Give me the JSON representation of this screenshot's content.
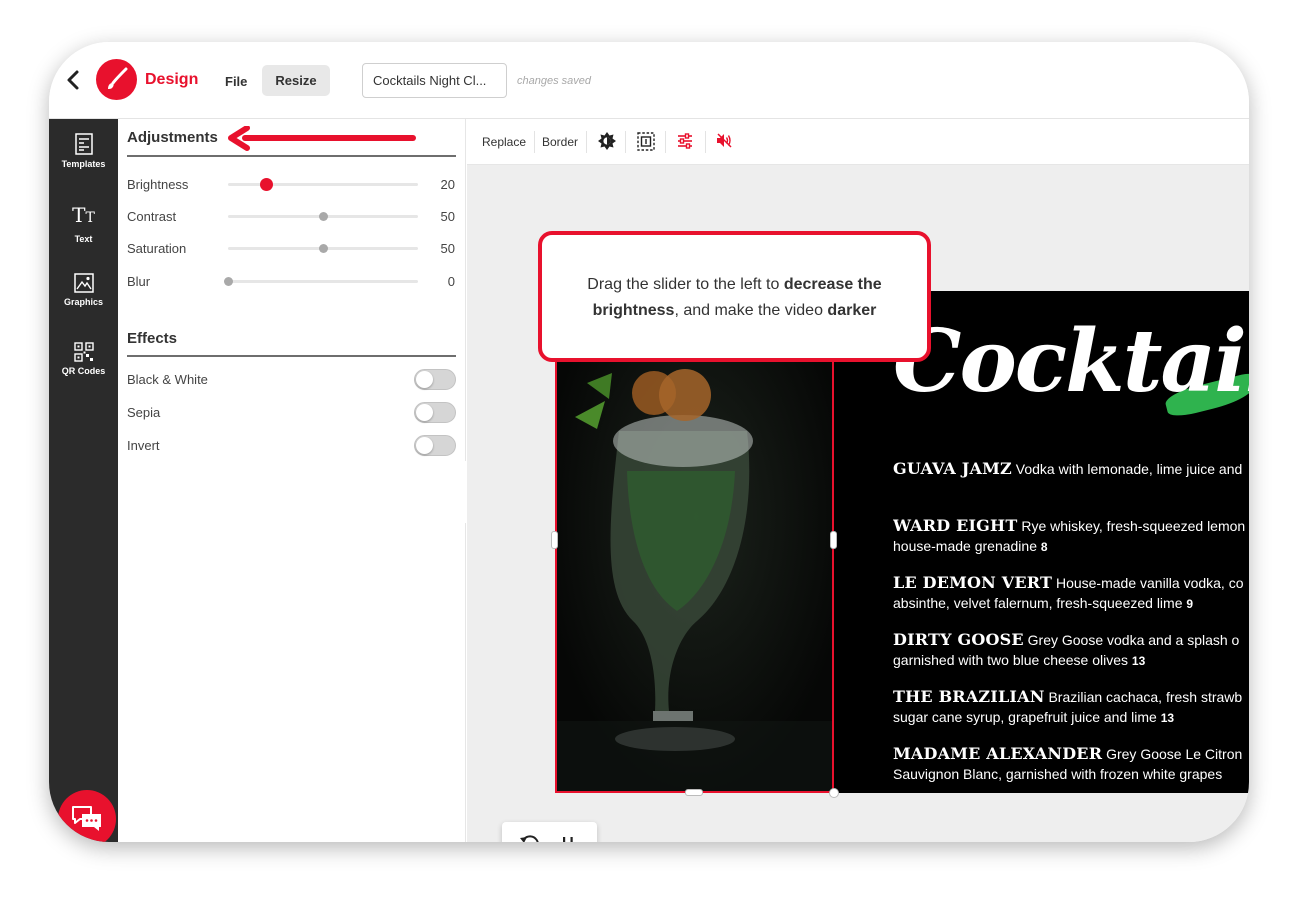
{
  "header": {
    "brand": "Design",
    "menu_file": "File",
    "menu_resize": "Resize",
    "document_title": "Cocktails Night Cl...",
    "save_status": "changes saved"
  },
  "rail": {
    "items": [
      {
        "label": "Templates",
        "icon": "templates-icon"
      },
      {
        "label": "Text",
        "icon": "text-icon"
      },
      {
        "label": "Graphics",
        "icon": "graphics-icon"
      },
      {
        "label": "QR Codes",
        "icon": "qr-code-icon"
      }
    ],
    "chat_icon": "chat-icon"
  },
  "adjustments": {
    "title": "Adjustments",
    "sliders": [
      {
        "label": "Brightness",
        "value": "20",
        "level": 0.2
      },
      {
        "label": "Contrast",
        "value": "50",
        "level": 0.5
      },
      {
        "label": "Saturation",
        "value": "50",
        "level": 0.5
      },
      {
        "label": "Blur",
        "value": "0",
        "level": 0.0
      }
    ]
  },
  "effects": {
    "title": "Effects",
    "toggles": [
      {
        "label": "Black & White",
        "on": false
      },
      {
        "label": "Sepia",
        "on": false
      },
      {
        "label": "Invert",
        "on": false
      }
    ]
  },
  "toolbar": {
    "replace": "Replace",
    "border": "Border",
    "icons": [
      "brightness-icon",
      "crop-icon",
      "adjust-sliders-icon",
      "mute-icon"
    ]
  },
  "tooltip": {
    "part1": "Drag the slider to the left to ",
    "bold1": "decrease the brightness",
    "part2": ", and make the video ",
    "bold2": "darker"
  },
  "design": {
    "heading": "Cocktails",
    "items": [
      {
        "name": "GUAVA JAMZ",
        "desc1": " Vodka with lemonade, lime juice and",
        "desc2": "",
        "price": ""
      },
      {
        "name": "WARD EIGHT",
        "desc1": " Rye whiskey, fresh-squeezed lemon",
        "desc2": "house-made grenadine ",
        "price": "8"
      },
      {
        "name": "LE DEMON VERT",
        "desc1": " House-made vanilla vodka, co",
        "desc2": "absinthe, velvet falernum, fresh-squeezed lime ",
        "price": "9"
      },
      {
        "name": "DIRTY GOOSE",
        "desc1": " Grey Goose vodka and a splash o",
        "desc2": "garnished with two blue cheese olives ",
        "price": "13"
      },
      {
        "name": "THE BRAZILIAN",
        "desc1": " Brazilian cachaca, fresh strawb",
        "desc2": "sugar cane syrup, grapefruit juice and lime ",
        "price": "13"
      },
      {
        "name": "MADAME ALEXANDER",
        "desc1": " Grey Goose Le Citron",
        "desc2": "Sauvignon Blanc, garnished with frozen white grapes",
        "price": ""
      }
    ]
  },
  "colors": {
    "accent": "#e8112d",
    "rail": "#2b2b2b",
    "canvas": "#eeeeee"
  }
}
